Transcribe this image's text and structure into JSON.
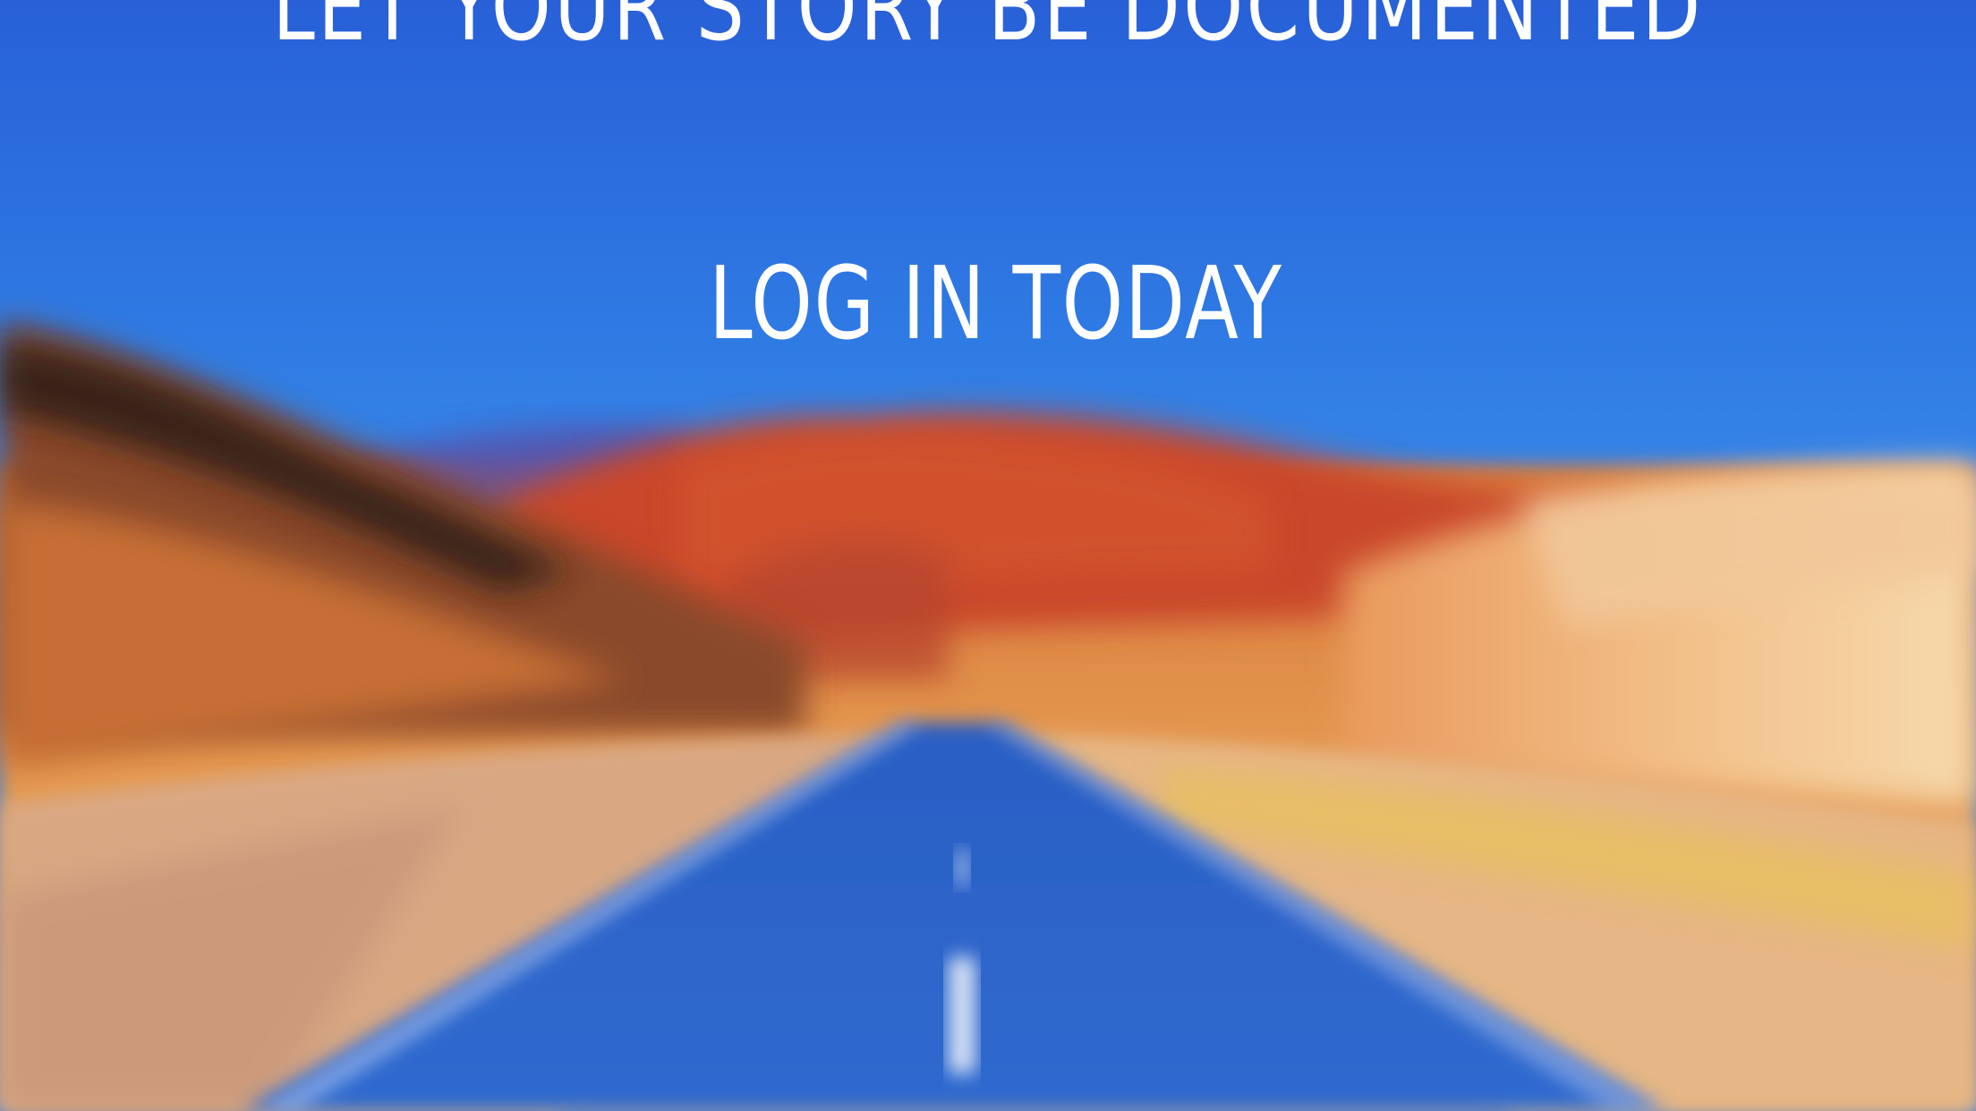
{
  "hero": {
    "tagline": "LET YOUR STORY BE DOCUMENTED",
    "cta_label": "LOG IN TODAY"
  },
  "colors": {
    "sky_top": "#2a64d9",
    "sky_horizon": "#3a86e8",
    "text": "#ffffff",
    "mountain_red": "#c8452a",
    "desert_orange": "#e3923f",
    "road_blue": "#2e64c4"
  },
  "background": {
    "scene": "blurred desert highway under blue sky"
  }
}
